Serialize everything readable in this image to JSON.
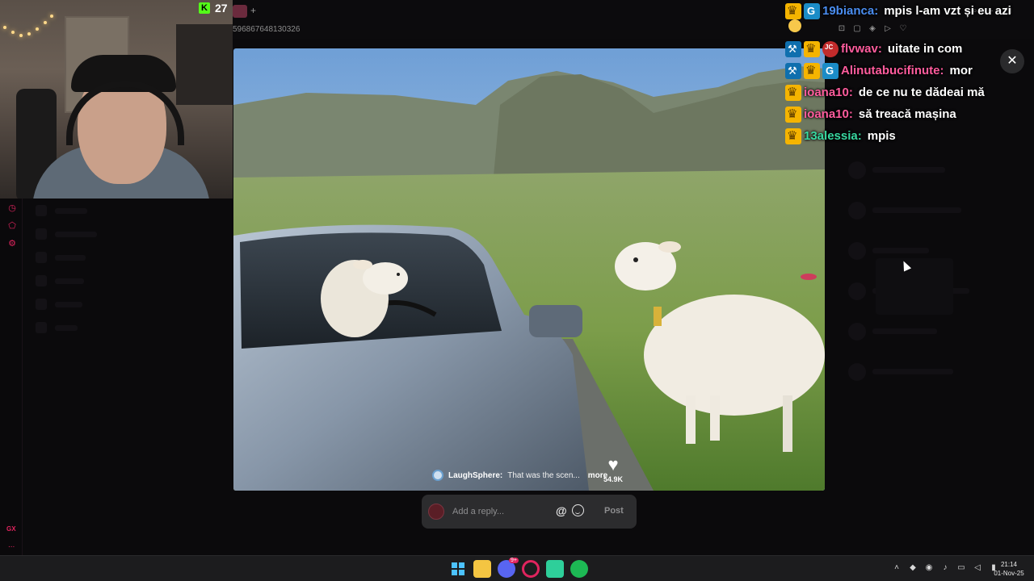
{
  "stream": {
    "viewer_count": "27",
    "url_fragment": "596867648130326"
  },
  "post": {
    "caption_user": "LaughSphere:",
    "caption_text": "That was the scen...",
    "caption_more": "more",
    "likes": "54.9K"
  },
  "reply": {
    "placeholder": "Add a reply...",
    "post_label": "Post",
    "mention_symbol": "@"
  },
  "chat": {
    "messages": [
      {
        "user": "19bianca:",
        "text": "mpis l-am vzt și eu azi",
        "color": "#4a8df0"
      },
      {
        "user": "flvwav:",
        "text": "uitate in com",
        "color": "#ff5c9d"
      },
      {
        "user": "Alinutabucifinute:",
        "text": "mor",
        "color": "#ff5c9d"
      },
      {
        "user": "ioana10:",
        "text": "de ce nu te dădeai mă",
        "color": "#ff5c9d"
      },
      {
        "user": "ioana10:",
        "text": "să treacă mașina",
        "color": "#ff5c9d"
      },
      {
        "user": "13alessia:",
        "text": "mpis",
        "color": "#38d8a0"
      }
    ]
  },
  "taskbar": {
    "discord_badge": "9+",
    "time": "21:14",
    "date": "01-Nov-25"
  },
  "sidebar": {
    "gx_label": "GX",
    "more_label": "..."
  }
}
